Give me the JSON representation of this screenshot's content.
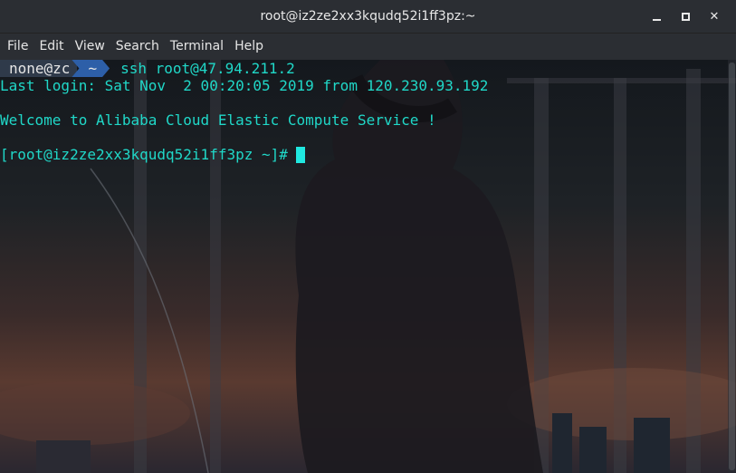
{
  "window": {
    "title": "root@iz2ze2xx3kqudq52i1ff3pz:~",
    "controls": {
      "minimize_icon": "minimize-icon",
      "maximize_icon": "maximize-icon",
      "close_label": "✕"
    }
  },
  "menu": [
    "File",
    "Edit",
    "View",
    "Search",
    "Terminal",
    "Help"
  ],
  "terminal": {
    "prompt_user": "none@zc",
    "prompt_dir": "~",
    "command": "ssh root@47.94.211.2",
    "last_login": "Last login: Sat Nov  2 00:20:05 2019 from 120.230.93.192",
    "welcome": "Welcome to Alibaba Cloud Elastic Compute Service !",
    "remote_prompt": "[root@iz2ze2xx3kqudq52i1ff3pz ~]#"
  },
  "colors": {
    "text": "#20d8c8",
    "cursor": "#20e8e0",
    "prompt_dir_bg": "#2d5fa8"
  }
}
